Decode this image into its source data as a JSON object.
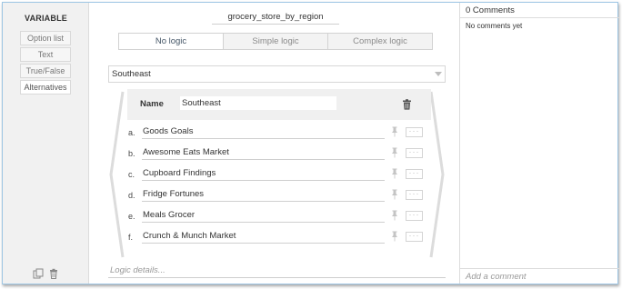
{
  "sidebar": {
    "heading": "VARIABLE",
    "types": [
      {
        "label": "Option list"
      },
      {
        "label": "Text"
      },
      {
        "label": "True/False"
      },
      {
        "label": "Alternatives",
        "active": true
      }
    ],
    "icons": [
      "copy-icon",
      "trash-icon"
    ]
  },
  "variable": {
    "name": "grocery_store_by_region"
  },
  "logic_tabs": [
    {
      "label": "No logic",
      "active": true
    },
    {
      "label": "Simple logic"
    },
    {
      "label": "Complex logic"
    }
  ],
  "region_select": {
    "value": "Southeast"
  },
  "group": {
    "name_label": "Name",
    "name_value": "Southeast"
  },
  "alternatives": [
    {
      "letter": "a.",
      "text": "Goods Goals"
    },
    {
      "letter": "b.",
      "text": "Awesome Eats Market"
    },
    {
      "letter": "c.",
      "text": "Cupboard Findings"
    },
    {
      "letter": "d.",
      "text": "Fridge Fortunes"
    },
    {
      "letter": "e.",
      "text": "Meals Grocer"
    },
    {
      "letter": "f.",
      "text": "Crunch & Munch Market"
    }
  ],
  "logic_details": {
    "placeholder": "Logic details..."
  },
  "comments": {
    "header": "0 Comments",
    "empty_text": "No comments yet",
    "add_placeholder": "Add a comment"
  },
  "colors": {
    "frame_border": "#9ec6e4",
    "sidebar_bg": "#f1f1f1",
    "panel_bg": "#f0f0f0"
  }
}
